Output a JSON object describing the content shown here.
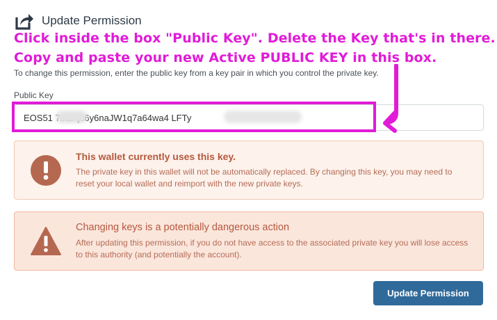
{
  "header": {
    "title": "Update Permission",
    "icon": "share-arrow-icon"
  },
  "annotation": {
    "line1": "Click inside the box \"Public Key\". Delete the Key that's in there.",
    "line2": "Copy and paste your new Active PUBLIC KEY in this box.",
    "color": "#e11bd8"
  },
  "description": "To change this permission, enter the public key from a key pair in which you control the private key.",
  "public_key": {
    "label": "Public Key",
    "visible_value": "EOS51         7sfzAjc6y6naJW1q7a64wa4                   LFTy"
  },
  "alerts": [
    {
      "icon": "exclamation-circle-icon",
      "title": "This wallet currently uses this key.",
      "body": "The private key in this wallet will not be automatically replaced. By changing this key, you may need to reset your local wallet and reimport with the new private keys."
    },
    {
      "icon": "warning-triangle-icon",
      "title": "Changing keys is a potentially dangerous action",
      "body": "After updating this permission, if you do not have access to the associated private key you will lose access to this authority (and potentially the account)."
    }
  ],
  "update_button": {
    "label": "Update Permission",
    "color": "#2f6a9a"
  }
}
